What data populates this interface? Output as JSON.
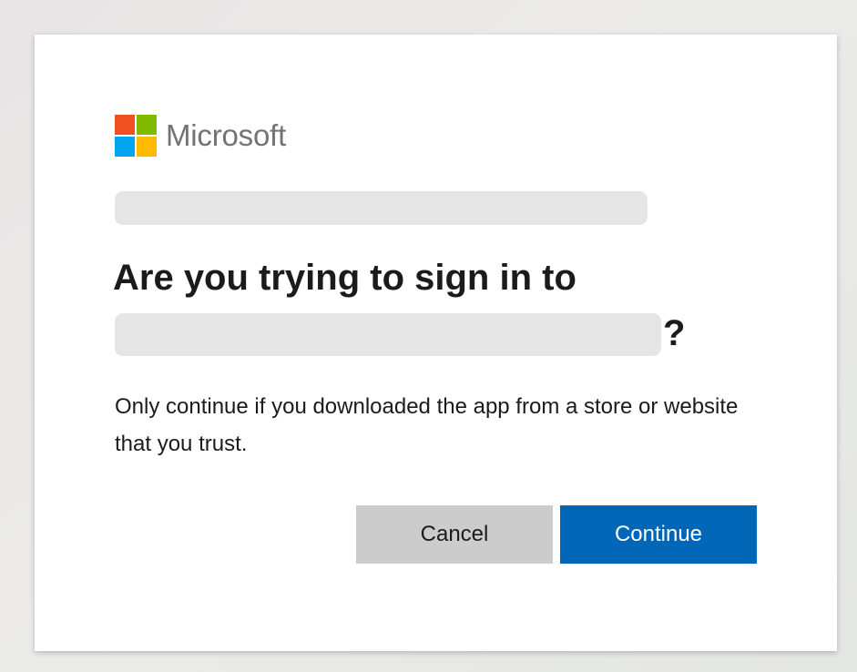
{
  "brand": {
    "name": "Microsoft",
    "logo_colors": [
      "#f25022",
      "#7fba00",
      "#00a4ef",
      "#ffb900"
    ]
  },
  "dialog": {
    "title_line1": "Are you trying to sign in to",
    "title_suffix": "?",
    "description": "Only continue if you downloaded the app from a store or website that you trust."
  },
  "buttons": {
    "cancel_label": "Cancel",
    "continue_label": "Continue"
  },
  "colors": {
    "primary": "#0067b8",
    "secondary_button": "#cccccc",
    "text": "#1b1b1b",
    "redaction": "#e5e5e5"
  }
}
